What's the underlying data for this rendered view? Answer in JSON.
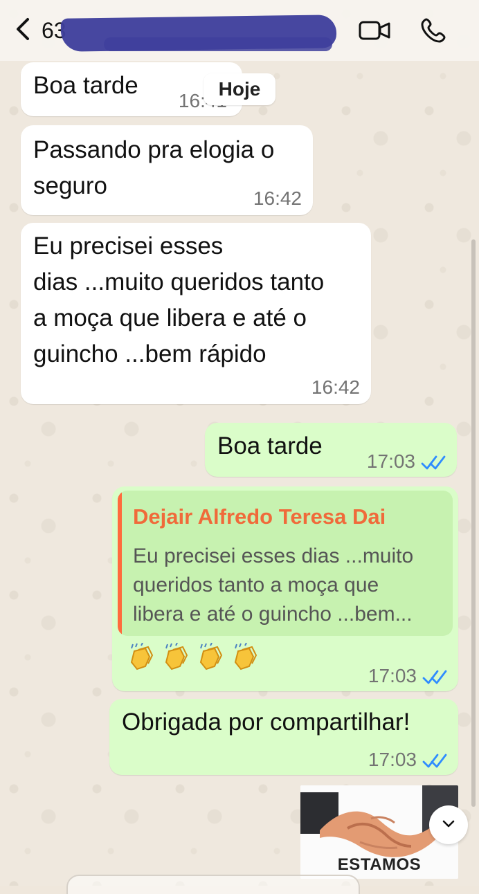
{
  "header": {
    "contact_name_prefix": "63",
    "icons": {
      "back": "chevron-left-icon",
      "video": "video-call-icon",
      "phone": "phone-icon"
    }
  },
  "chat": {
    "date_chip": "Hoje",
    "messages": [
      {
        "direction": "incoming",
        "text": "Boa tarde",
        "time": "16:41"
      },
      {
        "direction": "incoming",
        "text": "Passando pra elogia o\nseguro",
        "time": "16:42"
      },
      {
        "direction": "incoming",
        "text": "Eu precisei esses\ndias ...muito queridos tanto\na moça que libera e até o\nguincho ...bem rápido",
        "time": "16:42"
      },
      {
        "direction": "outgoing",
        "text": "Boa tarde",
        "time": "17:03"
      },
      {
        "direction": "outgoing",
        "quote_author": "Dejair Alfredo Teresa Dai",
        "quote_text": "Eu precisei esses dias ...muito\nqueridos tanto a moça que\nlibera e até o guincho ...bem...",
        "emoji_count": 4,
        "time": "17:03"
      },
      {
        "direction": "outgoing",
        "text": "Obrigada por compartilhar!",
        "time": "17:03"
      }
    ],
    "sticker_caption": "ESTAMOS"
  },
  "colors": {
    "incoming_bubble": "#ffffff",
    "outgoing_bubble": "#dafdc9",
    "quote_accent": "#ff6b3d",
    "read_receipt": "#2f8cff"
  }
}
